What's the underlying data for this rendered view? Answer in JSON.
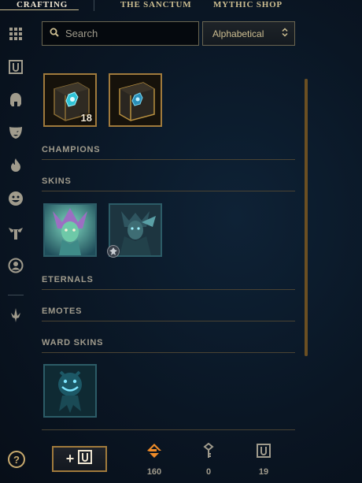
{
  "nav": {
    "tabs": [
      {
        "label": "CRAFTING",
        "active": true
      },
      {
        "label": "THE SANCTUM",
        "active": false
      },
      {
        "label": "MYTHIC SHOP",
        "active": false
      }
    ]
  },
  "sidebar": {
    "icons": [
      "grid-icon",
      "chest-icon",
      "helmet-icon",
      "mask-icon",
      "flame-icon",
      "emote-face-icon",
      "ward-icon",
      "profile-icon",
      "sword-icon"
    ]
  },
  "search": {
    "placeholder": "Search",
    "value": ""
  },
  "sort": {
    "selected": "Alphabetical"
  },
  "chests": [
    {
      "name": "hextech-chest",
      "count": "18"
    },
    {
      "name": "masterwork-chest",
      "count": ""
    }
  ],
  "sections": {
    "champions": "CHAMPIONS",
    "skins": "SKINS",
    "eternals": "ETERNALS",
    "emotes": "EMOTES",
    "ward_skins": "WARD SKINS"
  },
  "footer": {
    "add_label": "+",
    "currencies": [
      {
        "name": "orange-essence-icon",
        "value": "160"
      },
      {
        "name": "key-icon",
        "value": "0"
      },
      {
        "name": "mythic-chest-icon",
        "value": "19"
      }
    ],
    "help_label": "?"
  },
  "colors": {
    "gold": "#c8aa6e",
    "gold_dark": "#a07a3c",
    "text": "#cdbe91",
    "muted": "#a09b8c",
    "background": "#0a1624",
    "essence": "#f08c28"
  }
}
